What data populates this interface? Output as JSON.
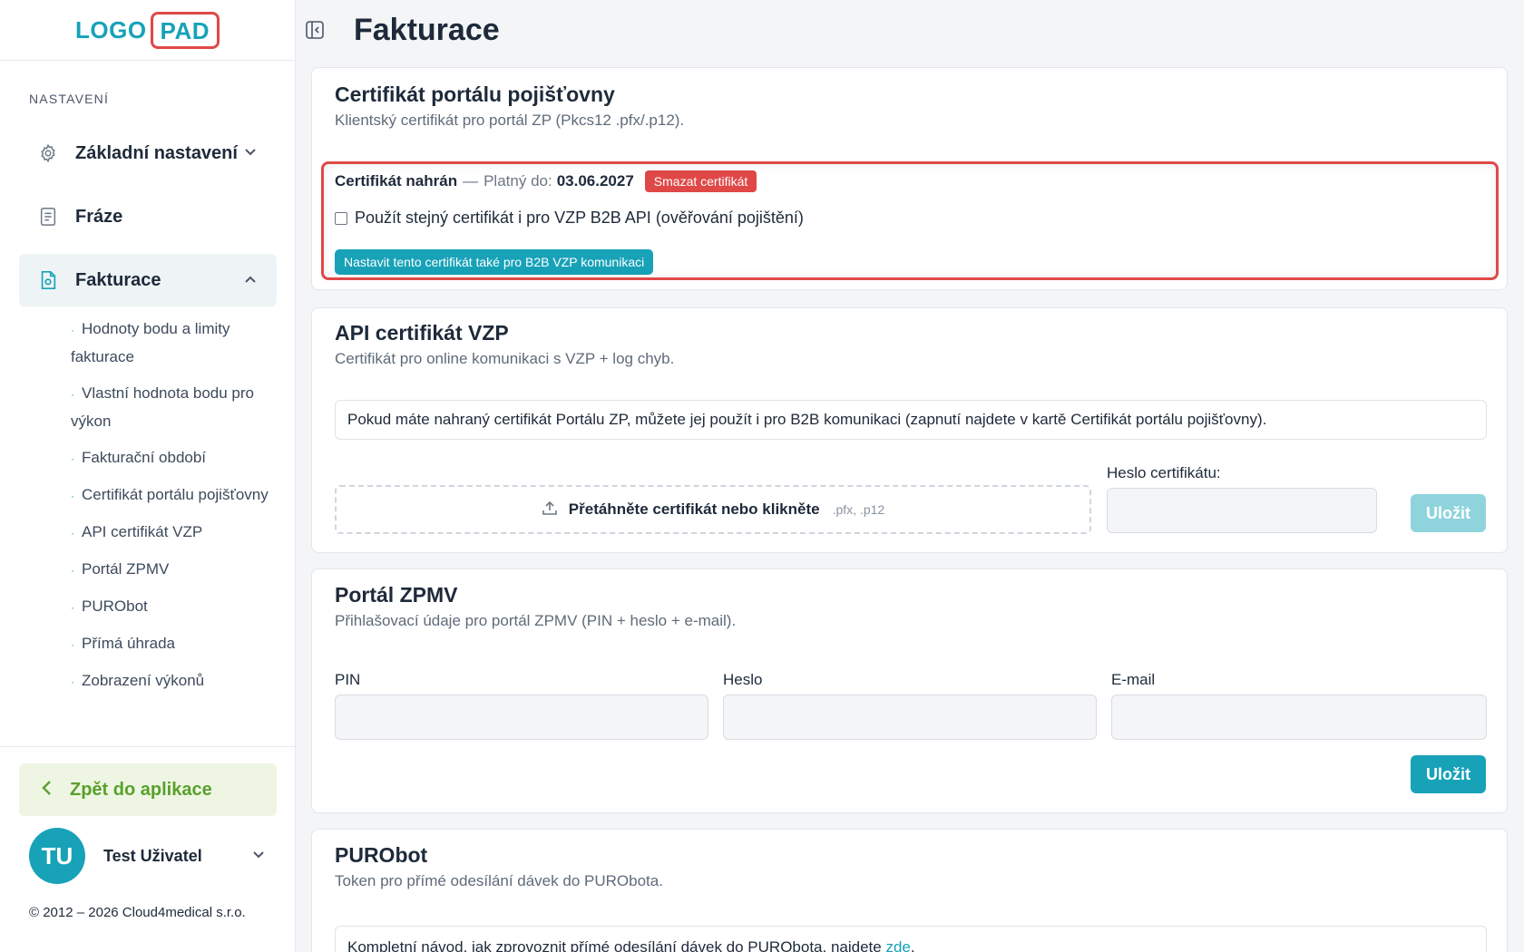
{
  "logo": {
    "part1": "LOGO",
    "part2": "PAD"
  },
  "sidebar": {
    "section_label": "NASTAVENÍ",
    "items": [
      {
        "label": "Základní nastavení",
        "icon": "gear-icon"
      },
      {
        "label": "Fráze",
        "icon": "document-icon"
      },
      {
        "label": "Fakturace",
        "icon": "invoice-icon"
      }
    ],
    "sub_items": [
      "Hodnoty bodu a limity fakturace",
      "Vlastní hodnota bodu pro výkon",
      "Fakturační období",
      "Certifikát portálu pojišťovny",
      "API certifikát VZP",
      "Portál ZPMV",
      "PURObot",
      "Přímá úhrada",
      "Zobrazení výkonů"
    ],
    "back_label": "Zpět do aplikace",
    "user": {
      "initials": "TU",
      "name": "Test Uživatel"
    },
    "copyright": "© 2012 – 2026 Cloud4medical s.r.o."
  },
  "header": {
    "title": "Fakturace"
  },
  "cert_card": {
    "title": "Certifikát portálu pojišťovny",
    "subtitle": "Klientský certifikát pro portál ZP (Pkcs12 .pfx/.p12).",
    "status_bold": "Certifikát nahrán",
    "status_dash": "—",
    "valid_label": "Platný do:",
    "valid_date": "03.06.2027",
    "delete_label": "Smazat certifikát",
    "checkbox_label": "Použít stejný certifikát i pro VZP B2B API (ověřování pojištění)",
    "set_b2b_label": "Nastavit tento certifikát také pro B2B VZP komunikaci"
  },
  "api_card": {
    "title": "API certifikát VZP",
    "subtitle": "Certifikát pro online komunikaci s VZP + log chyb.",
    "info": "Pokud máte nahraný certifikát Portálu ZP, můžete jej použít i pro B2B komunikaci (zapnutí najdete v kartě Certifikát portálu pojišťovny).",
    "dropzone_text": "Přetáhněte certifikát nebo klikněte",
    "dropzone_ext": ".pfx, .p12",
    "password_label": "Heslo certifikátu:",
    "save_label": "Uložit"
  },
  "zpmv_card": {
    "title": "Portál ZPMV",
    "subtitle": "Přihlašovací údaje pro portál ZPMV (PIN + heslo + e-mail).",
    "pin_label": "PIN",
    "password_label": "Heslo",
    "email_label": "E-mail",
    "save_label": "Uložit"
  },
  "purobot_card": {
    "title": "PURObot",
    "subtitle": "Token pro přímé odesílání dávek do PURObota.",
    "info_prefix": "Kompletní návod, jak zprovoznit přímé odesílání dávek do PURObota, najdete",
    "info_link": "zde",
    "info_suffix": "."
  }
}
